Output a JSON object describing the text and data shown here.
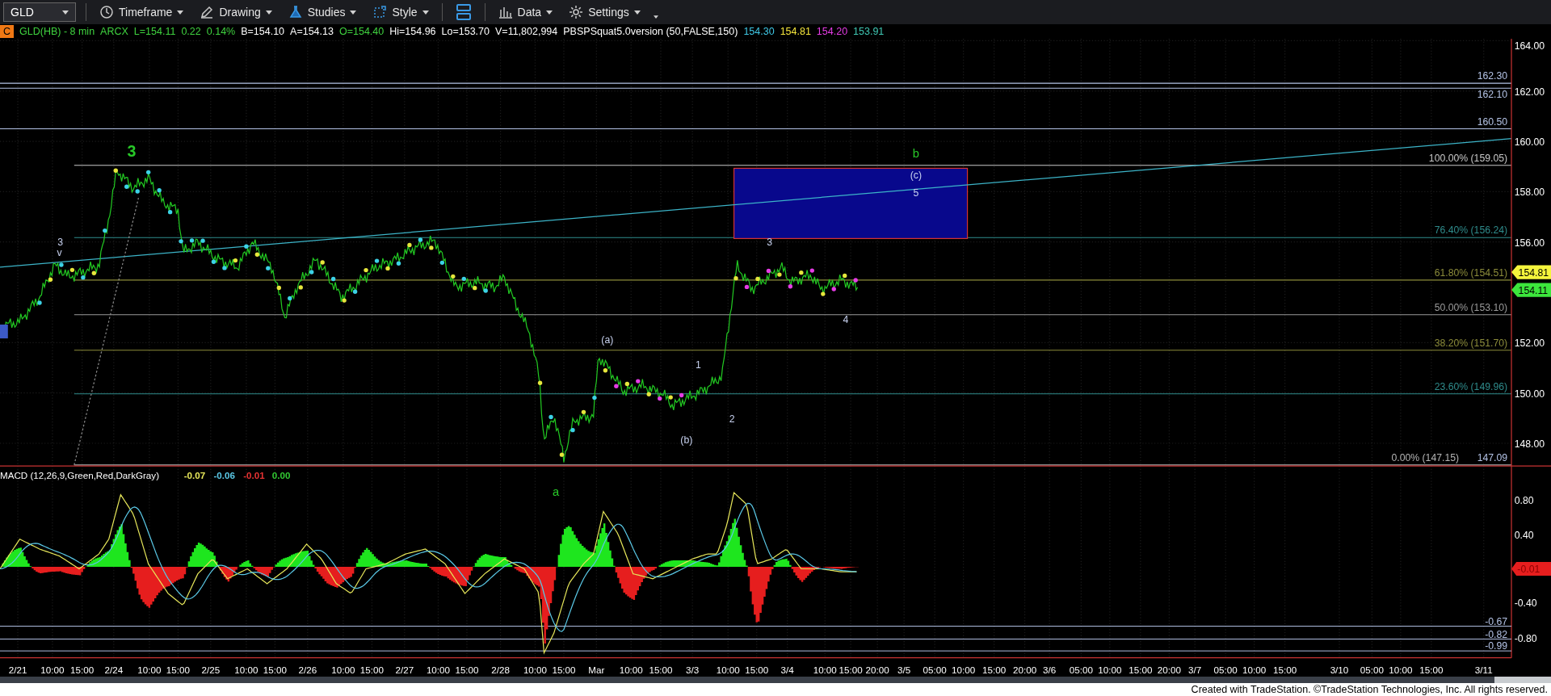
{
  "toolbar": {
    "symbol": "GLD",
    "menus": [
      {
        "label": "Timeframe",
        "kind": "clock"
      },
      {
        "label": "Drawing",
        "kind": "pencil"
      },
      {
        "label": "Studies",
        "kind": "flask"
      },
      {
        "label": "Style",
        "kind": "style"
      },
      {
        "kind": "layout"
      },
      {
        "label": "Data",
        "kind": "bars"
      },
      {
        "label": "Settings",
        "kind": "gear"
      }
    ]
  },
  "quote_header": {
    "badge": "C",
    "fields": [
      {
        "text": "GLD(HB) - 8 min",
        "color": "#3fd23f"
      },
      {
        "text": "ARCX",
        "color": "#3fd23f"
      },
      {
        "text": "L=154.11",
        "color": "#3fd23f"
      },
      {
        "text": "0.22",
        "color": "#3fd23f"
      },
      {
        "text": "0.14%",
        "color": "#3fd23f"
      },
      {
        "text": "B=154.10",
        "color": "#ffffff"
      },
      {
        "text": "A=154.13",
        "color": "#ffffff"
      },
      {
        "text": "O=154.40",
        "color": "#3fd23f"
      },
      {
        "text": "Hi=154.96",
        "color": "#ffffff"
      },
      {
        "text": "Lo=153.70",
        "color": "#ffffff"
      },
      {
        "text": "V=11,802,994",
        "color": "#ffffff"
      },
      {
        "text": "PBSPSquat5.0version (50,FALSE,150)",
        "color": "#ffffff"
      },
      {
        "text": "154.30",
        "color": "#3fc8e6"
      },
      {
        "text": "154.81",
        "color": "#f5e63c"
      },
      {
        "text": "154.20",
        "color": "#e63ce6"
      },
      {
        "text": "153.91",
        "color": "#3fc8b4"
      }
    ]
  },
  "price_chart": {
    "price_axis": [
      "164.00",
      "162.00",
      "160.00",
      "158.00",
      "156.00",
      "152.00",
      "150.00",
      "148.00"
    ],
    "levels": [
      {
        "label": "162.30",
        "color": "#b4c3e6"
      },
      {
        "label": "162.10",
        "color": "#b4c3e6"
      },
      {
        "label": "160.50",
        "color": "#b4c3e6"
      },
      {
        "label": "100.00% (159.05)",
        "color": "#c8c8c8"
      },
      {
        "label": "76.40% (156.24)",
        "color": "#2f8c8c"
      },
      {
        "label": "61.80% (154.51)",
        "color": "#8c8c3a"
      },
      {
        "label": "50.00% (153.10)",
        "color": "#9a9a9a"
      },
      {
        "label": "38.20% (151.70)",
        "color": "#8c8c3a"
      },
      {
        "label": "23.60% (149.96)",
        "color": "#2f8c8c"
      },
      {
        "label": "0.00% (147.15)",
        "color": "#b4b4b4"
      },
      {
        "label": "147.09",
        "color": "#b4c3e6"
      }
    ],
    "wave_labels": [
      {
        "text": "3",
        "kind": "major"
      },
      {
        "text": "3",
        "kind": "count"
      },
      {
        "text": "v",
        "kind": "count"
      },
      {
        "text": "b",
        "kind": "minor"
      },
      {
        "text": "(c)",
        "kind": "count"
      },
      {
        "text": "5",
        "kind": "count"
      },
      {
        "text": "3",
        "kind": "count"
      },
      {
        "text": "4",
        "kind": "count"
      },
      {
        "text": "(a)",
        "kind": "count"
      },
      {
        "text": "1",
        "kind": "count"
      },
      {
        "text": "2",
        "kind": "count"
      },
      {
        "text": "(b)",
        "kind": "count"
      },
      {
        "text": "a",
        "kind": "minor"
      }
    ],
    "price_tags": [
      {
        "text": "154.81",
        "color": "#f5f53c"
      },
      {
        "text": "154.11",
        "color": "#3ce63c"
      }
    ]
  },
  "macd": {
    "title": "MACD (12,26,9,Green,Red,DarkGray)",
    "values": [
      {
        "text": "-0.07",
        "color": "#e6e65a"
      },
      {
        "text": "-0.06",
        "color": "#5ac8e6"
      },
      {
        "text": "-0.01",
        "color": "#e63232"
      },
      {
        "text": "0.00",
        "color": "#32c832"
      }
    ],
    "axis": [
      "0.80",
      "0.40",
      "-0.40",
      "-0.80"
    ],
    "tag": "-0.01",
    "levels": [
      "-0.67",
      "-0.82",
      "-0.99"
    ]
  },
  "time_axis": [
    "2/21",
    "10:00",
    "15:00",
    "2/24",
    "10:00",
    "15:00",
    "2/25",
    "10:00",
    "15:00",
    "2/26",
    "10:00",
    "15:00",
    "2/27",
    "10:00",
    "15:00",
    "2/28",
    "10:00",
    "15:00",
    "Mar",
    "10:00",
    "15:00",
    "3/3",
    "10:00",
    "15:00",
    "3/4",
    "10:00",
    "15:00",
    "20:00",
    "3/5",
    "05:00",
    "10:00",
    "15:00",
    "20:00",
    "3/6",
    "05:00",
    "10:00",
    "15:00",
    "20:00",
    "3/7",
    "05:00",
    "10:00",
    "15:00",
    "3/10",
    "05:00",
    "10:00",
    "15:00",
    "3/11"
  ],
  "footer": "Created with TradeStation. ©TradeStation Technologies, Inc. All rights reserved."
}
